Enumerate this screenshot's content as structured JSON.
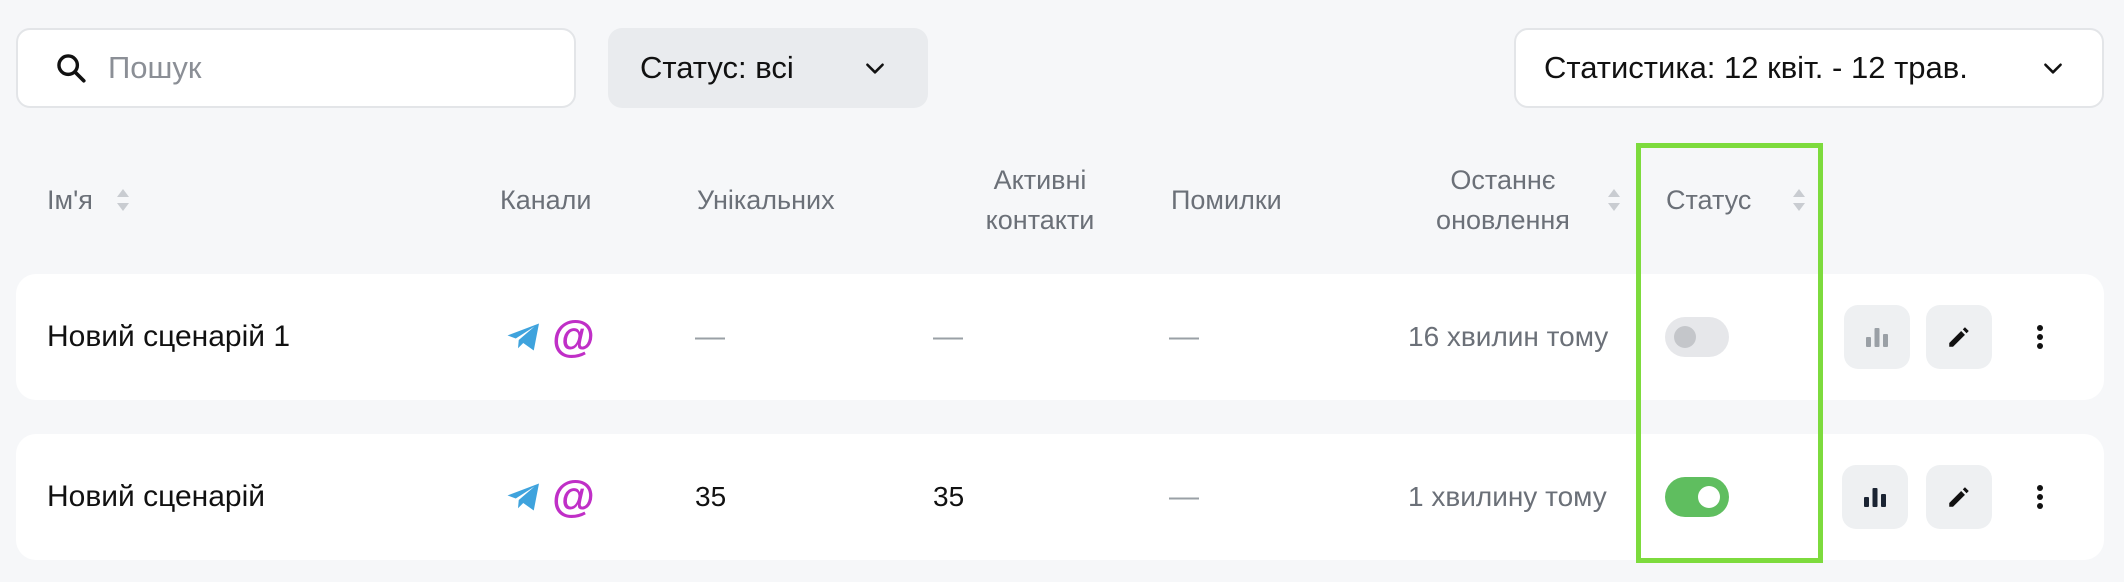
{
  "toolbar": {
    "search": {
      "placeholder": "Пошук",
      "icon": "search-icon"
    },
    "status_filter": {
      "label": "Статус: всі",
      "icon": "chevron-down-icon"
    },
    "stats_period": {
      "label": "Статистика: 12 квіт. - 12 трав.",
      "icon": "chevron-down-icon"
    }
  },
  "table": {
    "columns": [
      {
        "key": "name",
        "label": "Ім'я",
        "sortable": true
      },
      {
        "key": "channels",
        "label": "Канали",
        "sortable": false
      },
      {
        "key": "unique",
        "label": "Унікальних",
        "sortable": false
      },
      {
        "key": "active",
        "label": "Активні контакти",
        "sortable": false
      },
      {
        "key": "errors",
        "label": "Помилки",
        "sortable": false
      },
      {
        "key": "updated",
        "label": "Останнє оновлення",
        "sortable": true
      },
      {
        "key": "status",
        "label": "Статус",
        "sortable": true
      }
    ],
    "header": {
      "name": "Ім'я",
      "channels": "Канали",
      "unique": "Унікальних",
      "active_line1": "Активні",
      "active_line2": "контакти",
      "errors": "Помилки",
      "updated_line1": "Останнє",
      "updated_line2": "оновлення",
      "status": "Статус"
    },
    "rows": [
      {
        "name": "Новий сценарій 1",
        "channels": [
          "telegram-icon",
          "email-at-icon"
        ],
        "channel_at": "@",
        "unique": "—",
        "active": "—",
        "errors": "—",
        "updated": "16 хвилин тому",
        "status_on": false
      },
      {
        "name": "Новий сценарій",
        "channels": [
          "telegram-icon",
          "email-at-icon"
        ],
        "channel_at": "@",
        "unique": "35",
        "active": "35",
        "errors": "—",
        "updated": "1 хвилину тому",
        "status_on": true
      }
    ]
  },
  "colors": {
    "background": "#f6f7f9",
    "toggle_on": "#5fbe5f",
    "toggle_off": "#e6e7ea",
    "highlight": "#7ddb3d",
    "telegram": "#3fa3dd",
    "at_sign": "#c02fc7"
  }
}
